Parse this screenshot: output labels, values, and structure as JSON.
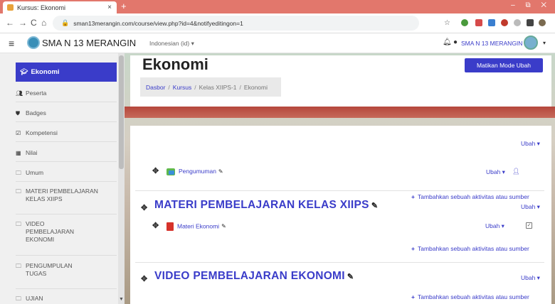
{
  "browser": {
    "tab_title": "Kursus: Ekonomi",
    "tab_close": "×",
    "new_tab": "+",
    "window_controls": "– ⧉ ✕",
    "url": "sman13merangin.com/course/view.php?id=4&notifyeditingon=1"
  },
  "navbar": {
    "site_name": "SMA N 13 MERANGIN",
    "language": "Indonesian (id) ▾",
    "user_name": "SMA N 13 MERANGIN",
    "user_caret": "▾"
  },
  "sidebar": {
    "active_label": "Ekonomi",
    "items": [
      {
        "label": "Peserta"
      },
      {
        "label": "Badges"
      },
      {
        "label": "Kompetensi"
      },
      {
        "label": "Nilai"
      },
      {
        "label": "Umum"
      },
      {
        "label": "MATERI PEMBELAJARAN KELAS XIIPS"
      },
      {
        "label": "VIDEO PEMBELAJARAN EKONOMI"
      },
      {
        "label": "PENGUMPULAN TUGAS"
      },
      {
        "label": "UJIAN"
      }
    ]
  },
  "header": {
    "title": "Ekonomi",
    "breadcrumb": [
      "Dasbor",
      "Kursus",
      "Kelas XIIPS-1",
      "Ekonomi"
    ],
    "edit_button": "Matikan Mode Ubah"
  },
  "sections": [
    {
      "title": "",
      "ubah": "Ubah ▾",
      "activity": "Pengumuman",
      "activity_ubah": "Ubah ▾",
      "add": "Tambahkan sebuah aktivitas atau sumber"
    },
    {
      "title": "MATERI PEMBELAJARAN KELAS XIIPS",
      "ubah": "Ubah ▾",
      "activity": "Materi Ekonomi",
      "activity_ubah": "Ubah ▾",
      "add": "Tambahkan sebuah aktivitas atau sumber"
    },
    {
      "title": "VIDEO PEMBELAJARAN EKONOMI",
      "ubah": "Ubah ▾",
      "add": "Tambahkan sebuah aktivitas atau sumber"
    }
  ],
  "colors": {
    "brand": "#3a3cc9",
    "tabbar": "#e2776c"
  }
}
